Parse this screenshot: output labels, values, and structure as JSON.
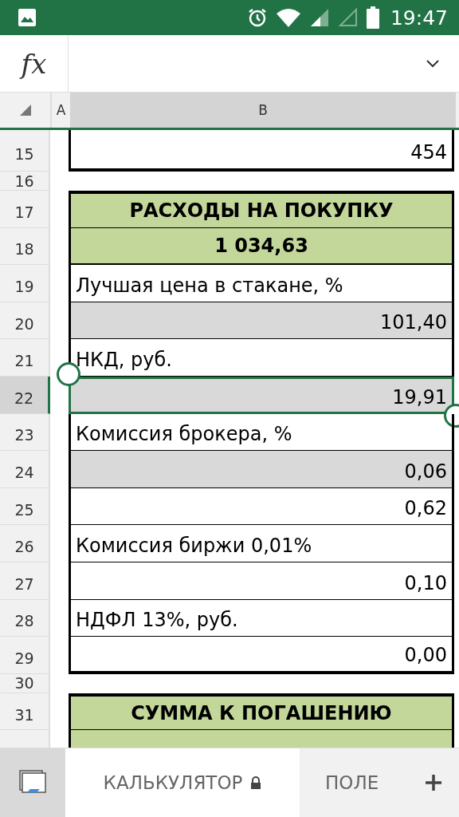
{
  "status_bar": {
    "time": "19:47"
  },
  "formula_bar": {
    "label": "fx"
  },
  "columns": [
    {
      "label": "A",
      "selected": false
    },
    {
      "label": "B",
      "selected": true
    }
  ],
  "rows": [
    {
      "number": "15",
      "kind": "value",
      "text": "454",
      "shaded": false,
      "selected": false
    },
    {
      "number": "16",
      "kind": "blank",
      "selected": false
    },
    {
      "number": "17",
      "kind": "header",
      "text": "РАСХОДЫ НА ПОКУПКУ",
      "shaded": true,
      "selected": false
    },
    {
      "number": "18",
      "kind": "total",
      "text": "1 034,63",
      "shaded": true,
      "selected": false
    },
    {
      "number": "19",
      "kind": "label",
      "text": "Лучшая цена в стакане, %",
      "shaded": false,
      "selected": false
    },
    {
      "number": "20",
      "kind": "value",
      "text": "101,40",
      "shaded": true,
      "selected": false
    },
    {
      "number": "21",
      "kind": "label",
      "text": "НКД, руб.",
      "shaded": false,
      "selected": false
    },
    {
      "number": "22",
      "kind": "value",
      "text": "19,91",
      "shaded": true,
      "selected": true
    },
    {
      "number": "23",
      "kind": "label",
      "text": "Комиссия брокера, %",
      "shaded": false,
      "selected": false
    },
    {
      "number": "24",
      "kind": "value",
      "text": "0,06",
      "shaded": true,
      "selected": false
    },
    {
      "number": "25",
      "kind": "value",
      "text": "0,62",
      "shaded": false,
      "selected": false
    },
    {
      "number": "26",
      "kind": "label",
      "text": "Комиссия биржи 0,01%",
      "shaded": false,
      "selected": false
    },
    {
      "number": "27",
      "kind": "value",
      "text": "0,10",
      "shaded": false,
      "selected": false
    },
    {
      "number": "28",
      "kind": "label",
      "text": "НДФЛ 13%, руб.",
      "shaded": false,
      "selected": false
    },
    {
      "number": "29",
      "kind": "value",
      "text": "0,00",
      "shaded": false,
      "selected": false
    },
    {
      "number": "30",
      "kind": "blank",
      "selected": false
    },
    {
      "number": "31",
      "kind": "header",
      "text": "СУММА К ПОГАШЕНИЮ",
      "shaded": true,
      "selected": false
    },
    {
      "kind": "total",
      "shaded": true,
      "selected": false
    }
  ],
  "sheet_tabs": [
    {
      "label": "КАЛЬКУЛЯТОР",
      "locked": true,
      "selected": true
    },
    {
      "label": "ПОЛЕ",
      "locked": false,
      "selected": false
    }
  ]
}
